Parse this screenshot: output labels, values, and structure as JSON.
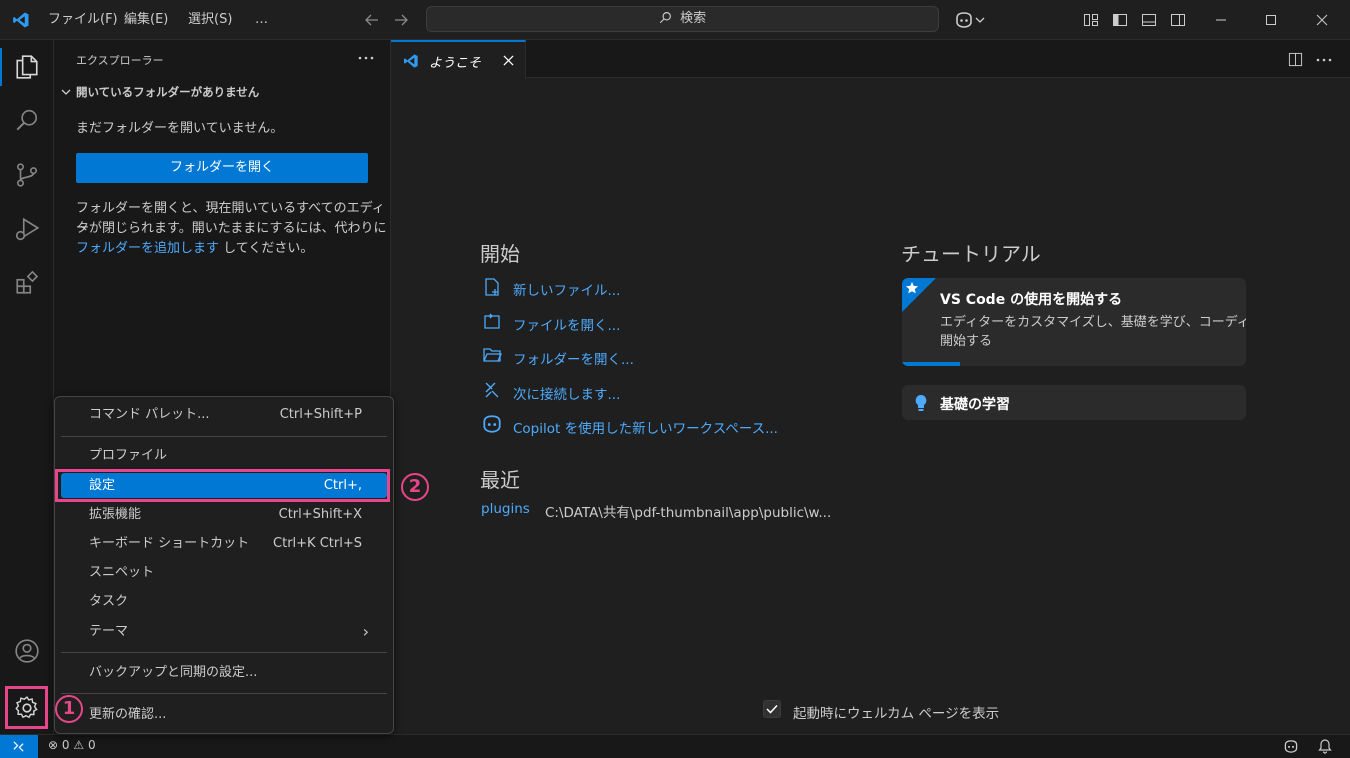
{
  "titlebar": {
    "menus": [
      "ファイル(F)",
      "編集(E)",
      "選択(S)",
      "…"
    ],
    "search_placeholder": "検索"
  },
  "sidebar": {
    "title": "エクスプローラー",
    "section": "開いているフォルダーがありません",
    "no_folder_text": "まだフォルダーを開いていません。",
    "open_folder_button": "フォルダーを開く",
    "info_line1": "フォルダーを開くと、現在開いているすべてのエディタ",
    "info_line2": "ーが閉じられます。開いたままにするには、代わりに",
    "info_link": "フォルダーを追加します",
    "info_suffix": " してください。"
  },
  "tab": {
    "label": "ようこそ"
  },
  "welcome": {
    "start_heading": "開始",
    "start_items": [
      "新しいファイル...",
      "ファイルを開く...",
      "フォルダーを開く...",
      "次に接続します...",
      "Copilot を使用した新しいワークスペース..."
    ],
    "recent_heading": "最近",
    "recent_name": "plugins",
    "recent_path": "C:\\DATA\\共有\\pdf-thumbnail\\app\\public\\w...",
    "tutorial_heading": "チュートリアル",
    "tutorial_card_title": "VS Code の使用を開始する",
    "tutorial_card_desc1": "エディターをカスタマイズし、基礎を学び、コーディングを",
    "tutorial_card_desc2": "開始する",
    "tutorial_card_progress": 0.17,
    "tutorial_basics": "基礎の学習",
    "show_on_startup": "起動時にウェルカム ページを表示"
  },
  "menu": {
    "items": [
      {
        "label": "コマンド パレット...",
        "shortcut": "Ctrl+Shift+P"
      },
      {
        "label": "プロファイル",
        "shortcut": ""
      },
      {
        "label": "設定",
        "shortcut": "Ctrl+,"
      },
      {
        "label": "拡張機能",
        "shortcut": "Ctrl+Shift+X"
      },
      {
        "label": "キーボード ショートカット",
        "shortcut": "Ctrl+K Ctrl+S"
      },
      {
        "label": "スニペット",
        "shortcut": ""
      },
      {
        "label": "タスク",
        "shortcut": ""
      },
      {
        "label": "テーマ",
        "shortcut": "›"
      },
      {
        "label": "バックアップと同期の設定...",
        "shortcut": ""
      },
      {
        "label": "更新の確認...",
        "shortcut": ""
      }
    ]
  },
  "callouts": [
    "1",
    "2"
  ],
  "statusbar": {
    "errors": "0",
    "warnings": "0"
  },
  "colors": {
    "accent": "#0078d4",
    "link": "#4daafc",
    "highlight": "#e8468a"
  }
}
